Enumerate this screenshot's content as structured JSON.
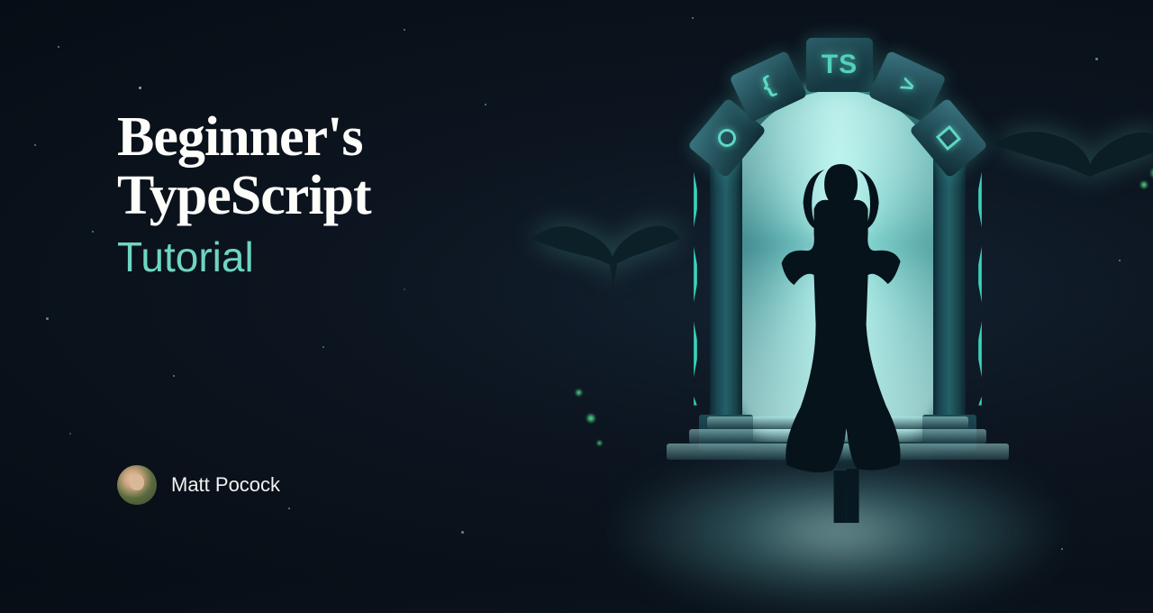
{
  "title_line1": "Beginner's",
  "title_line2": "TypeScript",
  "subtitle": "Tutorial",
  "author_name": "Matt Pocock",
  "portal_badge": "TS",
  "keystone_symbols": {
    "k1": "circle",
    "k2": "{",
    "k3": "TS",
    "k4": ">",
    "k5": "square"
  }
}
